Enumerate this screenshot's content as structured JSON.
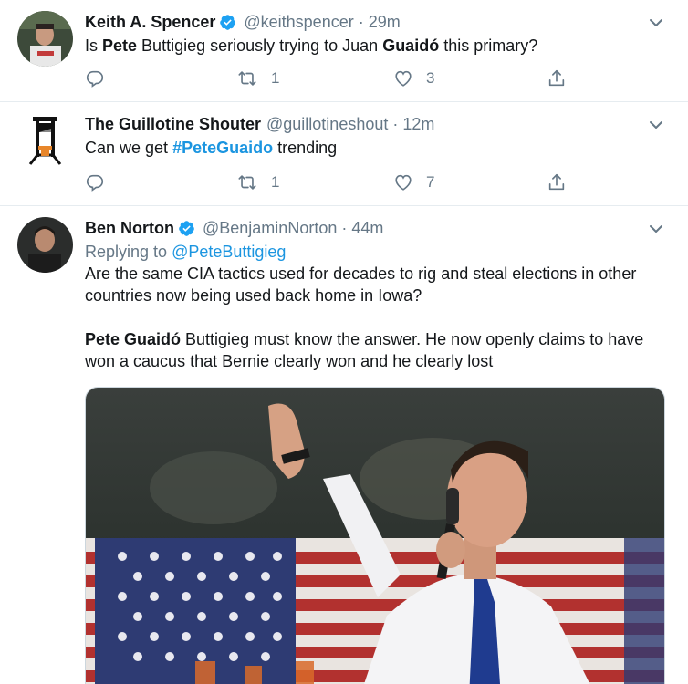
{
  "tweets": [
    {
      "name": "Keith A. Spencer",
      "handle": "@keithspencer",
      "separator": "·",
      "time": "29m",
      "text_parts": [
        "Is ",
        "Pete",
        " Buttigieg seriously trying to Juan ",
        "Guaidó",
        " this primary?"
      ],
      "replies": "",
      "retweets": "1",
      "likes": "3"
    },
    {
      "name": "The Guillotine Shouter",
      "handle": "@guillotineshout",
      "separator": "·",
      "time": "12m",
      "text_parts": [
        "Can we get ",
        "#PeteGuaido",
        " trending"
      ],
      "replies": "",
      "retweets": "1",
      "likes": "7"
    },
    {
      "name": "Ben Norton",
      "handle": "@BenjaminNorton",
      "separator": "·",
      "time": "44m",
      "replying_prefix": "Replying to ",
      "replying_to": "@PeteButtigieg",
      "para1": "Are the same CIA tactics used for decades to rig and steal elections in other countries now being used back home in Iowa?",
      "para2_bold": "Pete Guaidó",
      "para2_rest": " Buttigieg must know the answer. He now openly claims to have won a caucus that Bernie clearly won and he clearly lost"
    }
  ],
  "colors": {
    "link": "#1b95e0",
    "muted": "#657786",
    "text": "#14171a",
    "divider": "#e6ecf0"
  },
  "icons": [
    "verified-badge-icon",
    "caret-down-icon",
    "reply-icon",
    "retweet-icon",
    "like-icon",
    "share-icon"
  ]
}
